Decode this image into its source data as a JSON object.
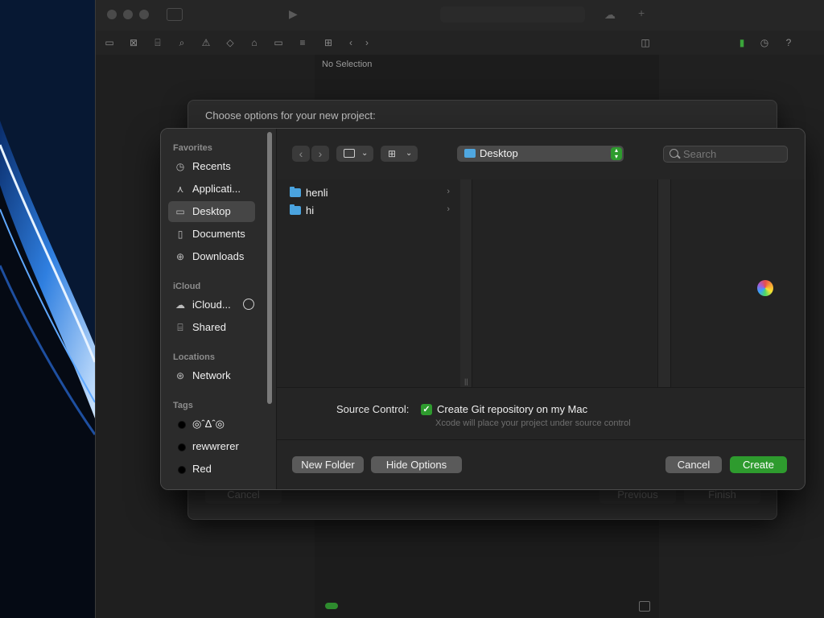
{
  "xcode": {
    "inspector_placeholder": "No Selection"
  },
  "sheet": {
    "title": "Choose options for your new project:",
    "cancel_label": "Cancel",
    "previous_label": "Previous",
    "finish_label": "Finish"
  },
  "sidebar": {
    "sections": {
      "favorites": "Favorites",
      "icloud": "iCloud",
      "locations": "Locations",
      "tags": "Tags"
    },
    "favorites": [
      {
        "label": "Recents",
        "icon": "clock-icon"
      },
      {
        "label": "Applicati...",
        "icon": "applications-icon"
      },
      {
        "label": "Desktop",
        "icon": "desktop-icon",
        "selected": true
      },
      {
        "label": "Documents",
        "icon": "document-icon"
      },
      {
        "label": "Downloads",
        "icon": "download-icon"
      }
    ],
    "icloud": [
      {
        "label": "iCloud...",
        "icon": "cloud-icon"
      },
      {
        "label": "Shared",
        "icon": "shared-folder-icon"
      }
    ],
    "locations": [
      {
        "label": "Network",
        "icon": "globe-icon"
      }
    ],
    "tags": [
      {
        "label": "◎ˆΔˆ◎",
        "color": "#000000"
      },
      {
        "label": "rewwrerer",
        "color": "#000000"
      },
      {
        "label": "Red",
        "color": "#000000"
      }
    ]
  },
  "toolbar": {
    "location": "Desktop",
    "search_placeholder": "Search"
  },
  "browser": {
    "items": [
      {
        "name": "henli"
      },
      {
        "name": "hi"
      }
    ]
  },
  "options": {
    "source_control_label": "Source Control:",
    "git_checkbox_label": "Create Git repository on my Mac",
    "git_checked": true,
    "git_note": "Xcode will place your project under source control"
  },
  "footer": {
    "new_folder": "New Folder",
    "hide_options": "Hide Options",
    "cancel": "Cancel",
    "create": "Create"
  },
  "colors": {
    "accent": "#2e9b2e",
    "folder": "#4aa3df"
  }
}
